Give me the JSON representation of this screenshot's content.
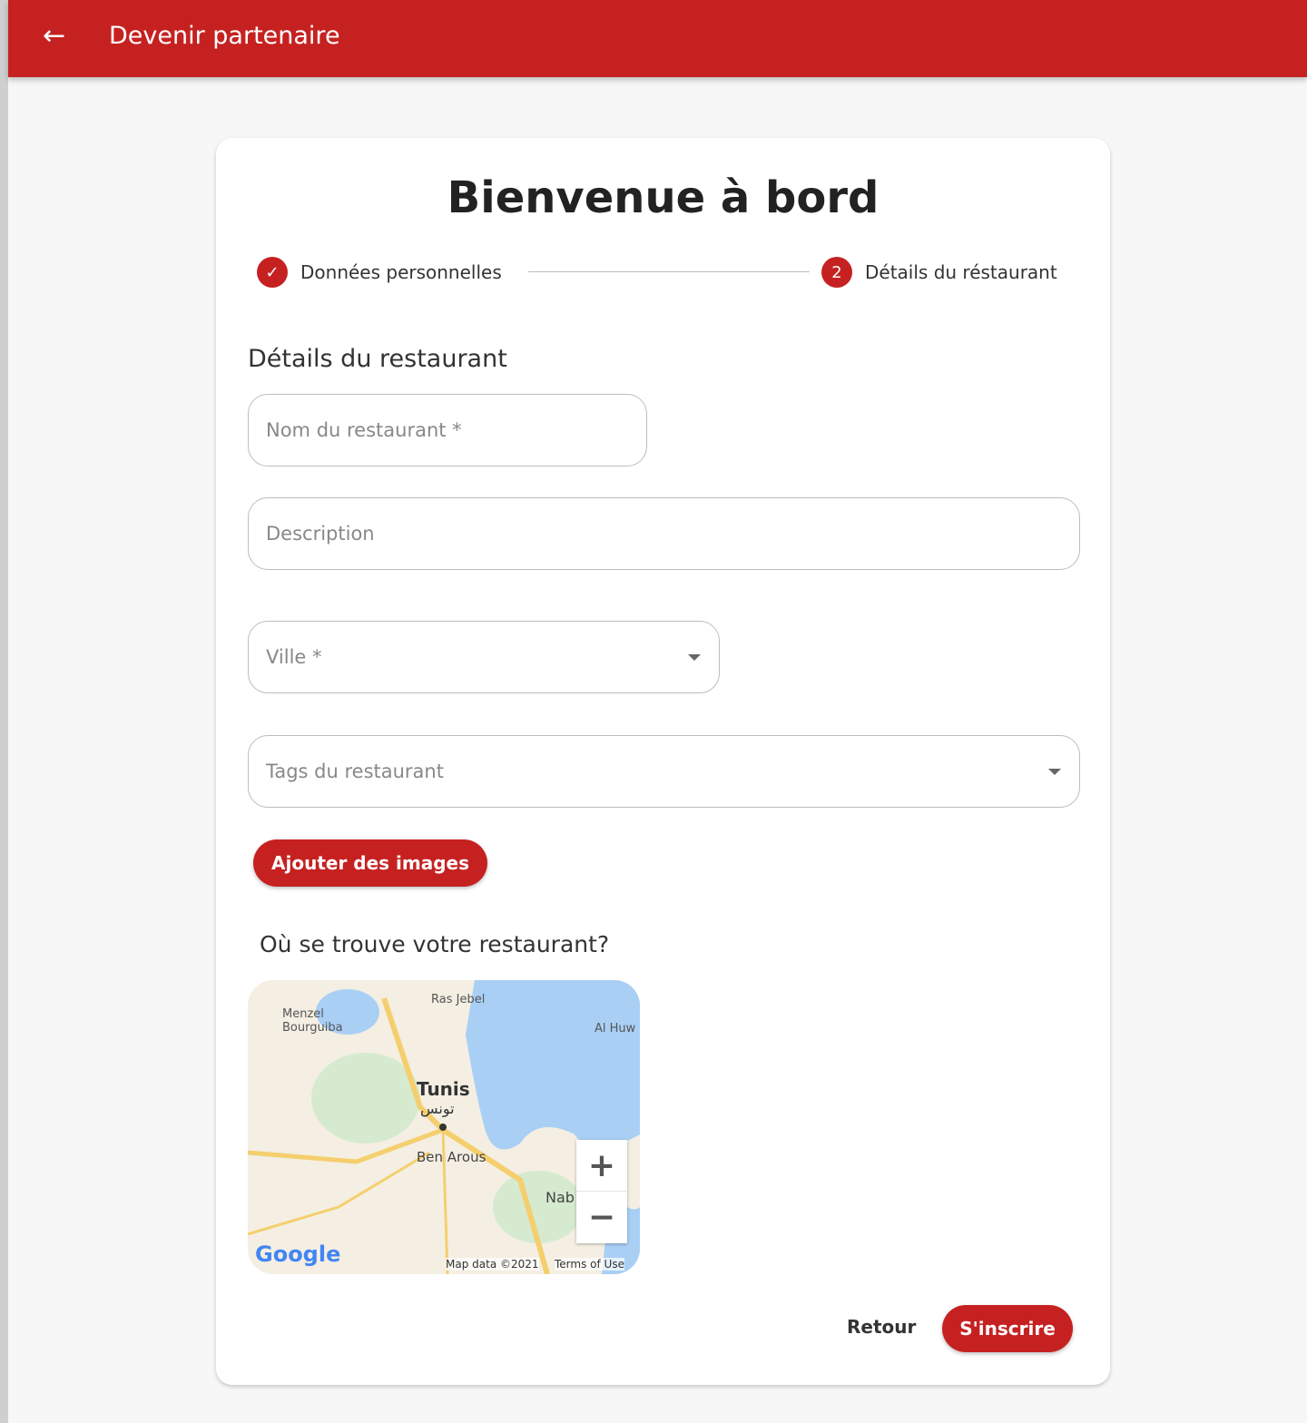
{
  "header": {
    "title": "Devenir partenaire",
    "back_icon": "arrow-left-icon"
  },
  "card": {
    "title": "Bienvenue à bord"
  },
  "stepper": [
    {
      "label": "Données personnelles",
      "state": "done",
      "icon": "check-icon"
    },
    {
      "label": "Détails du réstaurant",
      "number": "2",
      "state": "active"
    }
  ],
  "section_title": "Détails du restaurant",
  "fields": {
    "name": {
      "placeholder": "Nom du restaurant *",
      "value": ""
    },
    "description": {
      "placeholder": "Description",
      "value": ""
    },
    "city": {
      "placeholder": "Ville *",
      "value": ""
    },
    "tags": {
      "placeholder": "Tags du restaurant",
      "value": ""
    }
  },
  "add_images_label": "Ajouter des images",
  "map": {
    "question": "Où se trouve votre restaurant?",
    "labels": {
      "tunis": "Tunis",
      "tunis_ar": "تونس",
      "ben_arous": "Ben Arous",
      "ras_jebel": "Ras Jebel",
      "menzel": "Menzel Bourguiba",
      "nabeul": "Nab",
      "al_huw": "Al Huw"
    },
    "zoom_in": "+",
    "zoom_out": "−",
    "attribution": "Map data ©2021",
    "terms": "Terms of Use",
    "logo": "Google"
  },
  "actions": {
    "back": "Retour",
    "submit": "S'inscrire"
  },
  "colors": {
    "primary": "#c62121"
  }
}
